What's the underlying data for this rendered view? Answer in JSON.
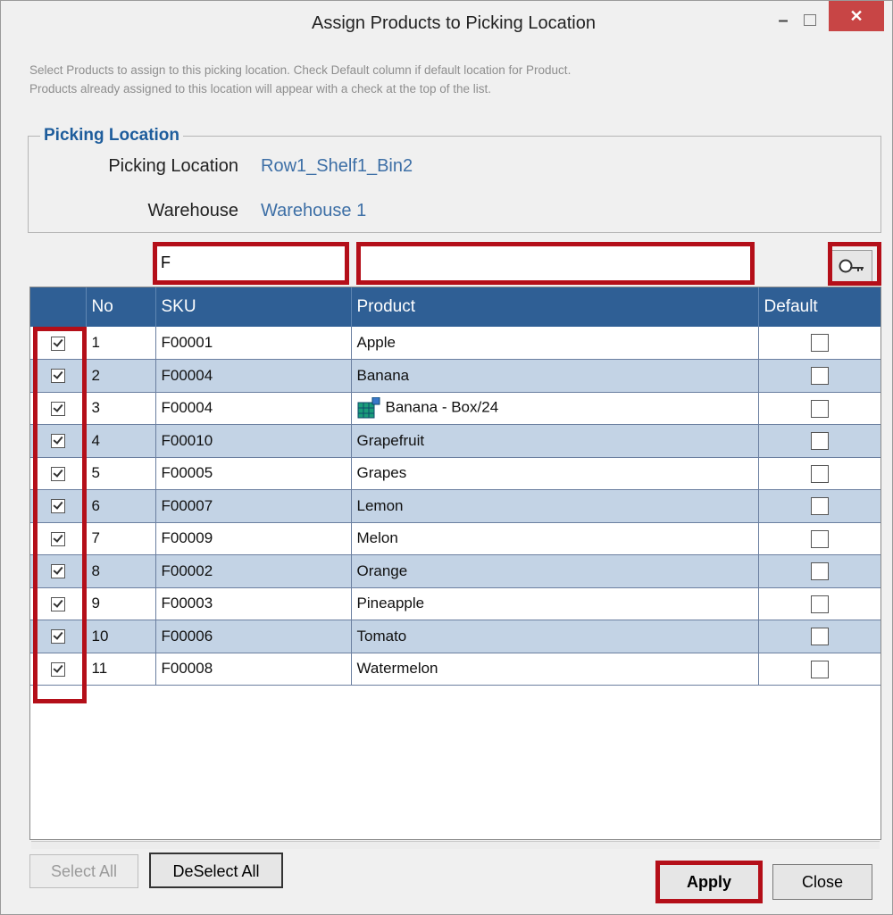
{
  "window": {
    "title": "Assign Products to Picking Location"
  },
  "description": {
    "line1": "Select Products to assign to this picking location. Check Default column if default location for Product.",
    "line2": "Products already assigned to this location will appear with a check at the top of the list."
  },
  "picking_group": {
    "legend": "Picking Location",
    "location_label": "Picking Location",
    "location_value": "Row1_Shelf1_Bin2",
    "warehouse_label": "Warehouse",
    "warehouse_value": "Warehouse 1"
  },
  "filters": {
    "sku_value": "F",
    "product_value": ""
  },
  "grid": {
    "columns": {
      "no": "No",
      "sku": "SKU",
      "product": "Product",
      "default": "Default"
    },
    "rows": [
      {
        "checked": true,
        "no": "1",
        "sku": "F00001",
        "product": "Apple",
        "default": false,
        "box_icon": false
      },
      {
        "checked": true,
        "no": "2",
        "sku": "F00004",
        "product": "Banana",
        "default": false,
        "box_icon": false
      },
      {
        "checked": true,
        "no": "3",
        "sku": "F00004",
        "product": "Banana - Box/24",
        "default": false,
        "box_icon": true
      },
      {
        "checked": true,
        "no": "4",
        "sku": "F00010",
        "product": "Grapefruit",
        "default": false,
        "box_icon": false
      },
      {
        "checked": true,
        "no": "5",
        "sku": "F00005",
        "product": "Grapes",
        "default": false,
        "box_icon": false
      },
      {
        "checked": true,
        "no": "6",
        "sku": "F00007",
        "product": "Lemon",
        "default": false,
        "box_icon": false
      },
      {
        "checked": true,
        "no": "7",
        "sku": "F00009",
        "product": "Melon",
        "default": false,
        "box_icon": false
      },
      {
        "checked": true,
        "no": "8",
        "sku": "F00002",
        "product": "Orange",
        "default": false,
        "box_icon": false
      },
      {
        "checked": true,
        "no": "9",
        "sku": "F00003",
        "product": "Pineapple",
        "default": false,
        "box_icon": false
      },
      {
        "checked": true,
        "no": "10",
        "sku": "F00006",
        "product": "Tomato",
        "default": false,
        "box_icon": false
      },
      {
        "checked": true,
        "no": "11",
        "sku": "F00008",
        "product": "Watermelon",
        "default": false,
        "box_icon": false
      }
    ]
  },
  "buttons": {
    "select_all": "Select All",
    "deselect_all": "DeSelect All",
    "apply": "Apply",
    "close": "Close"
  },
  "icons": {
    "search": "search-icon",
    "box": "box-pack-icon",
    "close": "close-icon",
    "minimize": "minimize-icon",
    "maximize": "maximize-icon"
  },
  "colors": {
    "header": "#2f5f95",
    "alt_row": "#c3d3e5",
    "highlight": "#b40f19",
    "link_text": "#3d6fa6"
  }
}
